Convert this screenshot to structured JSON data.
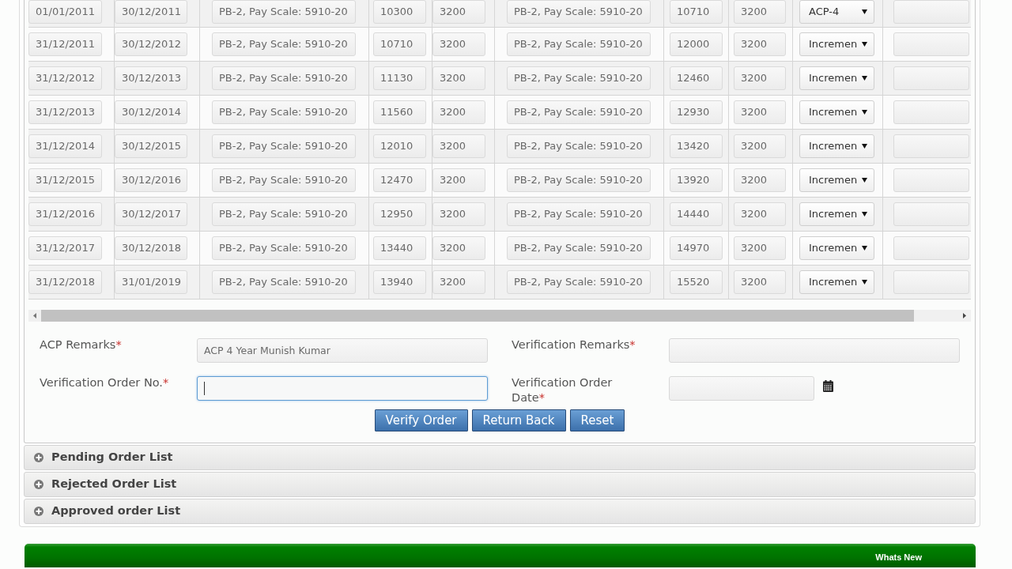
{
  "table": {
    "rows": [
      {
        "cells": [
          "01/01/2011",
          "30/12/2011",
          "PB-2, Pay Scale: 5910-20",
          "10300",
          "3200",
          "PB-2, Pay Scale: 5910-20",
          "10710",
          "3200"
        ],
        "dropdown": "ACP-4"
      },
      {
        "cells": [
          "31/12/2011",
          "30/12/2012",
          "PB-2, Pay Scale: 5910-20",
          "10710",
          "3200",
          "PB-2, Pay Scale: 5910-20",
          "12000",
          "3200"
        ],
        "dropdown": "Incremen"
      },
      {
        "cells": [
          "31/12/2012",
          "30/12/2013",
          "PB-2, Pay Scale: 5910-20",
          "11130",
          "3200",
          "PB-2, Pay Scale: 5910-20",
          "12460",
          "3200"
        ],
        "dropdown": "Incremen"
      },
      {
        "cells": [
          "31/12/2013",
          "30/12/2014",
          "PB-2, Pay Scale: 5910-20",
          "11560",
          "3200",
          "PB-2, Pay Scale: 5910-20",
          "12930",
          "3200"
        ],
        "dropdown": "Incremen"
      },
      {
        "cells": [
          "31/12/2014",
          "30/12/2015",
          "PB-2, Pay Scale: 5910-20",
          "12010",
          "3200",
          "PB-2, Pay Scale: 5910-20",
          "13420",
          "3200"
        ],
        "dropdown": "Incremen"
      },
      {
        "cells": [
          "31/12/2015",
          "30/12/2016",
          "PB-2, Pay Scale: 5910-20",
          "12470",
          "3200",
          "PB-2, Pay Scale: 5910-20",
          "13920",
          "3200"
        ],
        "dropdown": "Incremen"
      },
      {
        "cells": [
          "31/12/2016",
          "30/12/2017",
          "PB-2, Pay Scale: 5910-20",
          "12950",
          "3200",
          "PB-2, Pay Scale: 5910-20",
          "14440",
          "3200"
        ],
        "dropdown": "Incremen"
      },
      {
        "cells": [
          "31/12/2017",
          "30/12/2018",
          "PB-2, Pay Scale: 5910-20",
          "13440",
          "3200",
          "PB-2, Pay Scale: 5910-20",
          "14970",
          "3200"
        ],
        "dropdown": "Incremen"
      },
      {
        "cells": [
          "31/12/2018",
          "31/01/2019",
          "PB-2, Pay Scale: 5910-20",
          "13940",
          "3200",
          "PB-2, Pay Scale: 5910-20",
          "15520",
          "3200"
        ],
        "dropdown": "Incremen"
      }
    ]
  },
  "form": {
    "fields": [
      {
        "kind": "text",
        "label": "ACP Remarks",
        "required_mark": "*",
        "value": "ACP 4 Year Munish Kumar",
        "focused": false
      },
      {
        "kind": "text",
        "label": "Verification Remarks",
        "required_mark": "*",
        "focused": false
      },
      {
        "kind": "text",
        "label": "Verification Order No.",
        "required_mark": "*",
        "focused": true
      },
      {
        "kind": "date",
        "label": "Verification Order Date",
        "required_mark": "*",
        "focused": false
      }
    ]
  },
  "buttons": [
    "Verify Order",
    "Return Back",
    "Reset"
  ],
  "sections": [
    {
      "title": "Pending Order List",
      "expanded": false
    },
    {
      "title": "Rejected Order List",
      "expanded": false
    },
    {
      "title": "Approved order List",
      "expanded": false
    }
  ],
  "footer": {
    "link": "Whats New"
  }
}
